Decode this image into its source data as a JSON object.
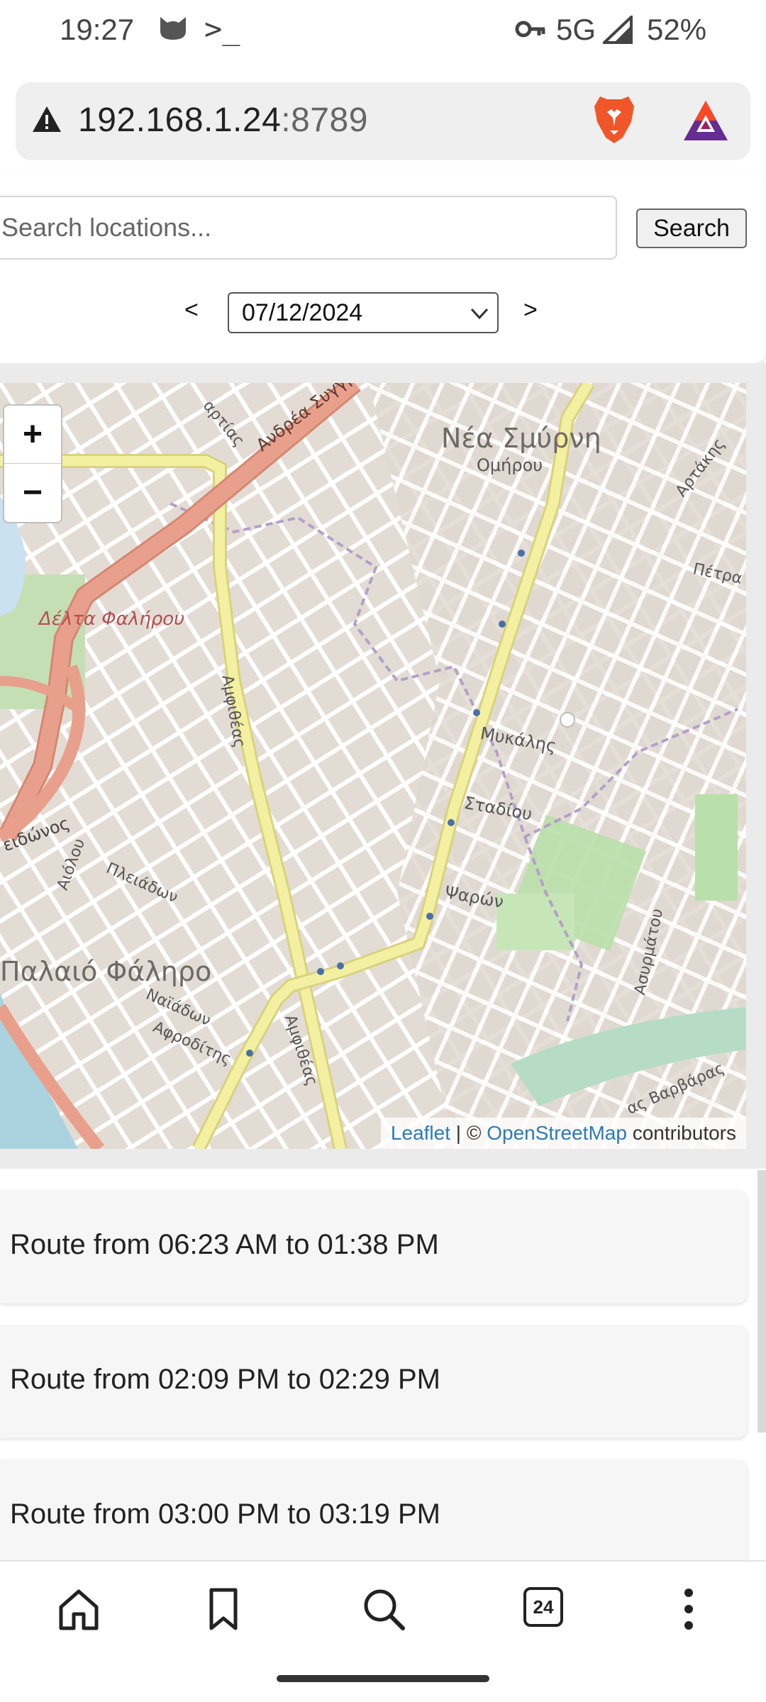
{
  "status_bar": {
    "time": "19:27",
    "terminal_glyph": ">_",
    "network": "5G",
    "battery": "52%"
  },
  "browser": {
    "url_host": "192.168.1.24",
    "url_port": ":8789",
    "tab_count": "24"
  },
  "search": {
    "placeholder": "Search locations...",
    "button_label": "Search"
  },
  "date_nav": {
    "prev_label": "<",
    "selected_date": "07/12/2024",
    "next_label": ">"
  },
  "map": {
    "zoom_in_label": "+",
    "zoom_out_label": "−",
    "attribution_leaflet": "Leaflet",
    "attribution_sep": " | © ",
    "attribution_osm": "OpenStreetMap",
    "attribution_suffix": " contributors",
    "labels": {
      "nea_smyrni": "Νέα Σμύρνη",
      "omirou": "Ομήρου",
      "andrea_syngrou": "Ανδρέα Συγγρού",
      "artakis": "Αρτάκης",
      "petra": "Πέτρα",
      "delta_falirou": "Δέλτα Φαλήρου",
      "amfitheas_1": "Αμφιθέας",
      "mykalis": "Μυκάλης",
      "stadiou": "Σταδίου",
      "psaron": "Ψαρών",
      "poseidonos": "ειδώνος",
      "aiolou": "Αιόλου",
      "pleiadon": "Πλειάδων",
      "palaio_faliro": "Παλαιό Φάληρο",
      "naiadon": "Ναϊάδων",
      "afroditis": "Αφροδίτης",
      "amfitheas_2": "Αμφιθέας",
      "asyrmatou": "Ασυρμάτου",
      "vasvaras": "ας Βαρβάρας",
      "dothis": "αρτίας"
    }
  },
  "routes": [
    {
      "label": "Route from 06:23 AM to 01:38 PM"
    },
    {
      "label": "Route from 02:09 PM to 02:29 PM"
    },
    {
      "label": "Route from 03:00 PM to 03:19 PM"
    }
  ],
  "colors": {
    "accent_link": "#2c7ab8",
    "map_primary_road": "#e8a08c",
    "map_secondary_road": "#f4f0a2",
    "map_park": "#b9dfaa",
    "map_water": "#aad3df"
  }
}
